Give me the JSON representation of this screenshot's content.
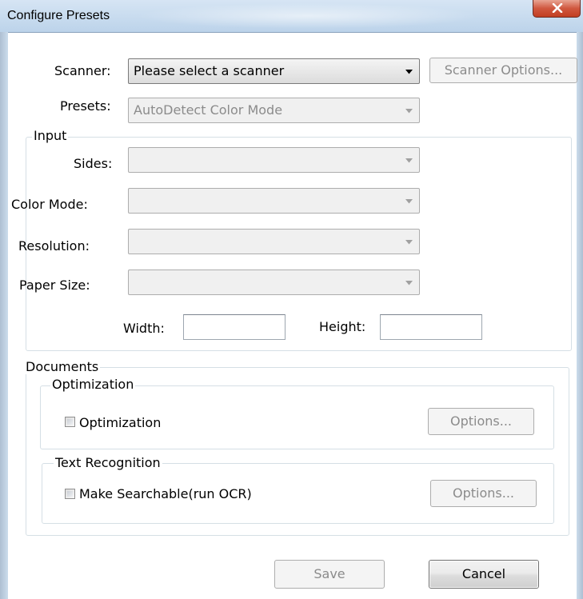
{
  "window": {
    "title": "Configure Presets",
    "close_label": "X"
  },
  "scanner": {
    "label": "Scanner:",
    "value": "Please select a scanner",
    "options_button": "Scanner Options..."
  },
  "presets": {
    "label": "Presets:",
    "value": "AutoDetect Color Mode"
  },
  "input_group": {
    "title": "Input",
    "sides_label": "Sides:",
    "color_mode_label": "Color Mode:",
    "resolution_label": "Resolution:",
    "paper_size_label": "Paper Size:",
    "width_label": "Width:",
    "height_label": "Height:",
    "width_value": "",
    "height_value": ""
  },
  "documents_group": {
    "title": "Documents",
    "optimization": {
      "title": "Optimization",
      "checkbox_label": "Optimization",
      "checked": false,
      "options_button": "Options..."
    },
    "text_recognition": {
      "title": "Text Recognition",
      "checkbox_label": "Make Searchable(run OCR)",
      "checked": false,
      "options_button": "Options..."
    }
  },
  "footer": {
    "save_button": "Save",
    "cancel_button": "Cancel"
  },
  "colors": {
    "title_bar": "#c9dcef",
    "close_button": "#c94b2e",
    "disabled_text": "#8b8b8b",
    "group_border": "#d5dfe5"
  },
  "icons": {
    "close": "close-icon",
    "dropdown": "chevron-down-icon"
  }
}
